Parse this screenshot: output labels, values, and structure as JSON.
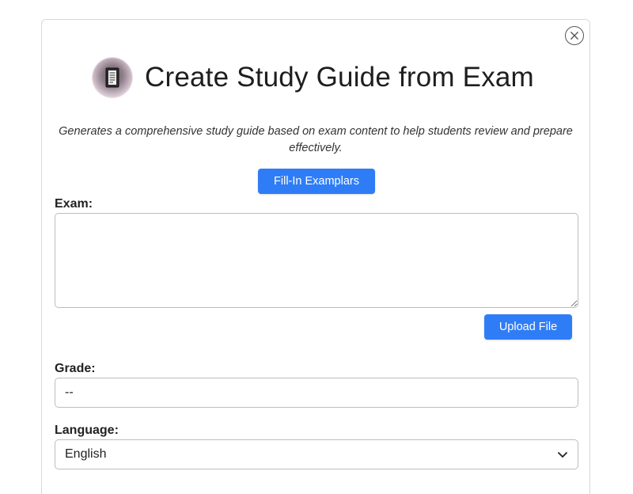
{
  "dialog": {
    "title": "Create Study Guide from Exam",
    "description": "Generates a comprehensive study guide based on exam content to help students review and prepare effectively.",
    "fill_in_button": "Fill-In Examplars",
    "logo_icon": "notebook-icon",
    "close_icon": "close-icon"
  },
  "form": {
    "exam": {
      "label": "Exam:",
      "value": "",
      "upload_button": "Upload File"
    },
    "grade": {
      "label": "Grade:",
      "value": "--"
    },
    "language": {
      "label": "Language:",
      "selected": "English",
      "icon": "chevron-down-icon"
    }
  },
  "colors": {
    "accent": "#2f7df6",
    "border": "#bdbdbd"
  }
}
